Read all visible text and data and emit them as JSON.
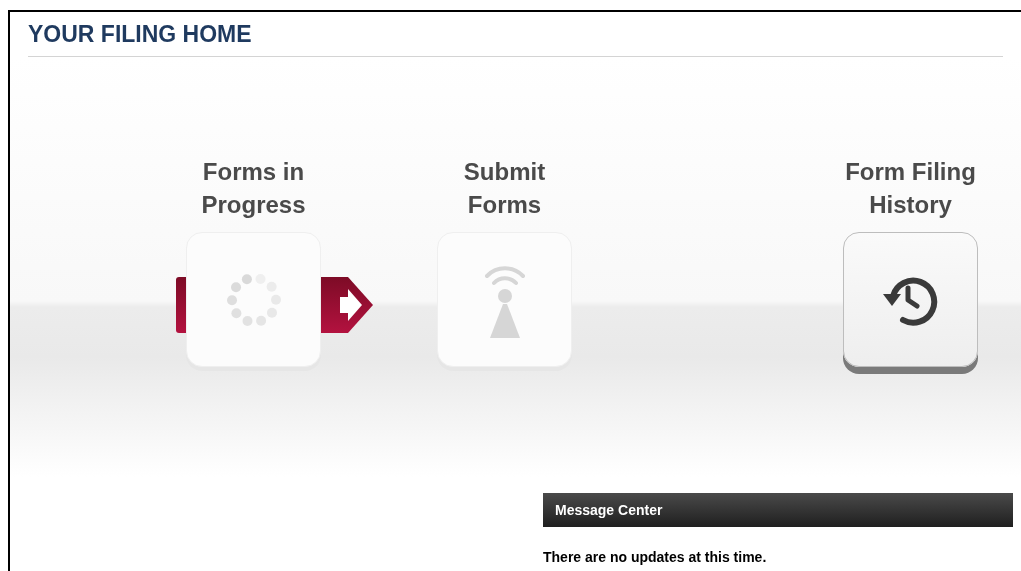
{
  "title": "YOUR FILING HOME",
  "tiles": [
    {
      "label_lines": [
        "Forms in",
        "Progress"
      ],
      "kind": "spinner",
      "selected": true,
      "disabled": true
    },
    {
      "label_lines": [
        "Submit",
        "Forms"
      ],
      "kind": "antenna",
      "selected": false,
      "disabled": true
    },
    {
      "label_lines": [
        "Form Filing",
        "History"
      ],
      "kind": "history",
      "selected": false,
      "disabled": false
    }
  ],
  "message_center": {
    "title": "Message Center",
    "message": "There are no updates at this time."
  }
}
